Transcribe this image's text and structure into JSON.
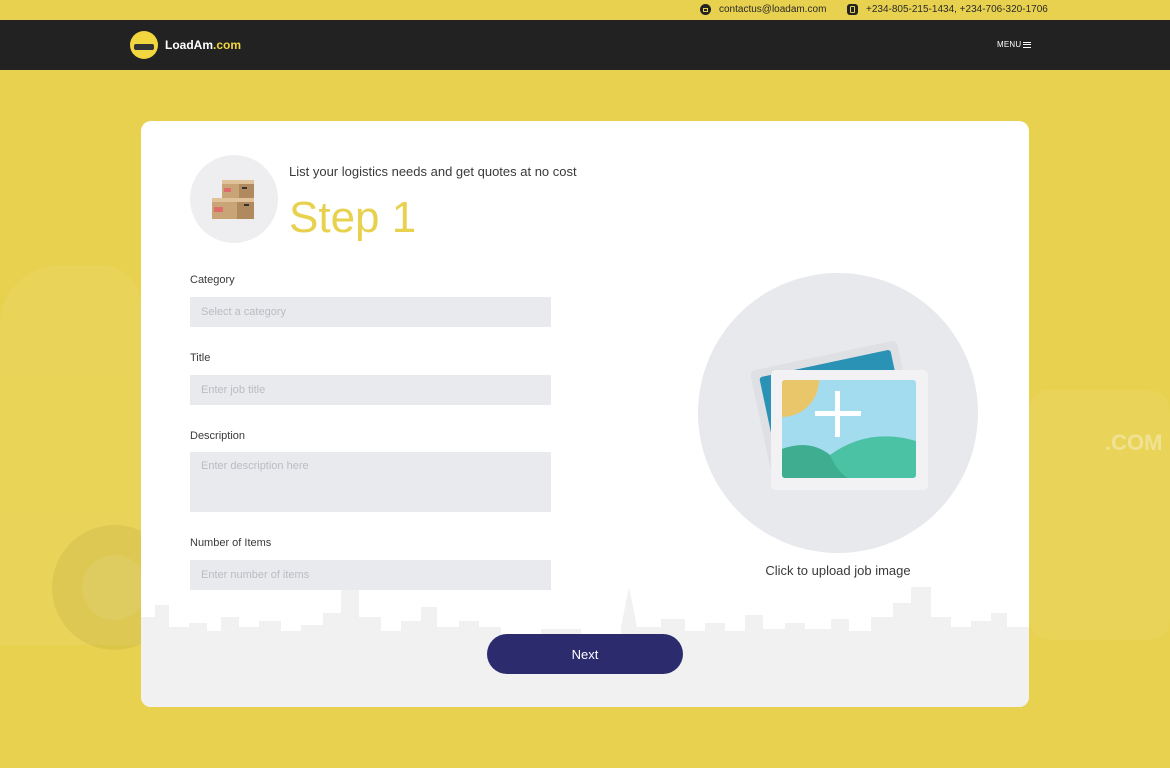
{
  "topbar": {
    "email": "contactus@loadam.com",
    "phones": "+234-805-215-1434, +234-706-320-1706"
  },
  "nav": {
    "logo_name": "LoadAm",
    "logo_domain": ".com",
    "menu_label": "MENU"
  },
  "background": {
    "watermark": ".COM"
  },
  "form": {
    "subtitle": "List your logistics needs and get quotes at no cost",
    "step_title": "Step 1",
    "category": {
      "label": "Category",
      "placeholder": "Select a category"
    },
    "title": {
      "label": "Title",
      "placeholder": "Enter job title"
    },
    "description": {
      "label": "Description",
      "placeholder": "Enter description here"
    },
    "items": {
      "label": "Number of Items",
      "placeholder": "Enter number of items"
    },
    "upload_caption": "Click to upload job image",
    "next_label": "Next"
  },
  "colors": {
    "brand_yellow": "#e8d14e",
    "navbar": "#222222",
    "button": "#2c2b6e",
    "field_bg": "#e9eaed"
  }
}
